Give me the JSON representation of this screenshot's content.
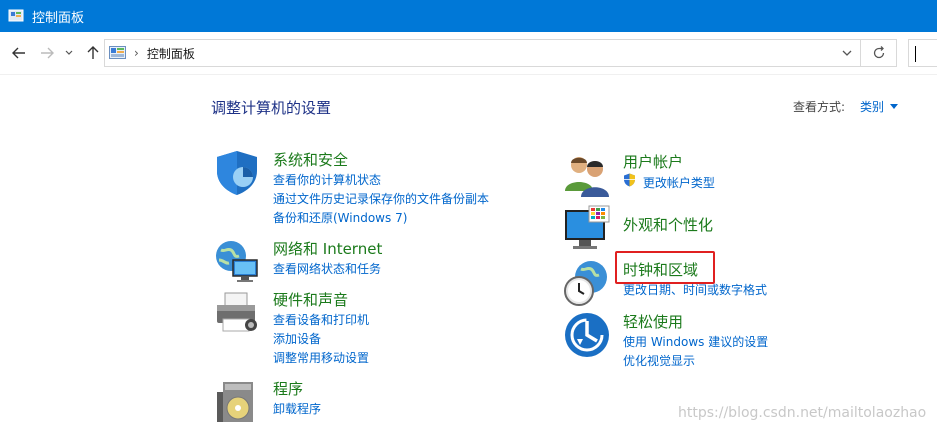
{
  "window": {
    "title": "控制面板"
  },
  "address": {
    "crumb": "控制面板",
    "separator": "›"
  },
  "page": {
    "heading": "调整计算机的设置",
    "view_by_label": "查看方式:",
    "view_by_value": "类别"
  },
  "categories": {
    "system_security": {
      "title": "系统和安全",
      "links": [
        "查看你的计算机状态",
        "通过文件历史记录保存你的文件备份副本",
        "备份和还原(Windows 7)"
      ]
    },
    "network": {
      "title": "网络和 Internet",
      "links": [
        "查看网络状态和任务"
      ]
    },
    "hardware": {
      "title": "硬件和声音",
      "links": [
        "查看设备和打印机",
        "添加设备",
        "调整常用移动设置"
      ]
    },
    "programs": {
      "title": "程序",
      "links": [
        "卸载程序"
      ]
    },
    "user_accounts": {
      "title": "用户帐户",
      "links": [
        "更改帐户类型"
      ]
    },
    "appearance": {
      "title": "外观和个性化",
      "links": []
    },
    "clock_region": {
      "title": "时钟和区域",
      "links": [
        "更改日期、时间或数字格式"
      ]
    },
    "ease_access": {
      "title": "轻松使用",
      "links": [
        "使用 Windows 建议的设置",
        "优化视觉显示"
      ]
    }
  },
  "watermark": "https://blog.csdn.net/mailtolaozhao",
  "colors": {
    "titlebar": "#0078d7",
    "category_title": "#1b7a1b",
    "link": "#0066cc",
    "highlight": "#e02020"
  }
}
